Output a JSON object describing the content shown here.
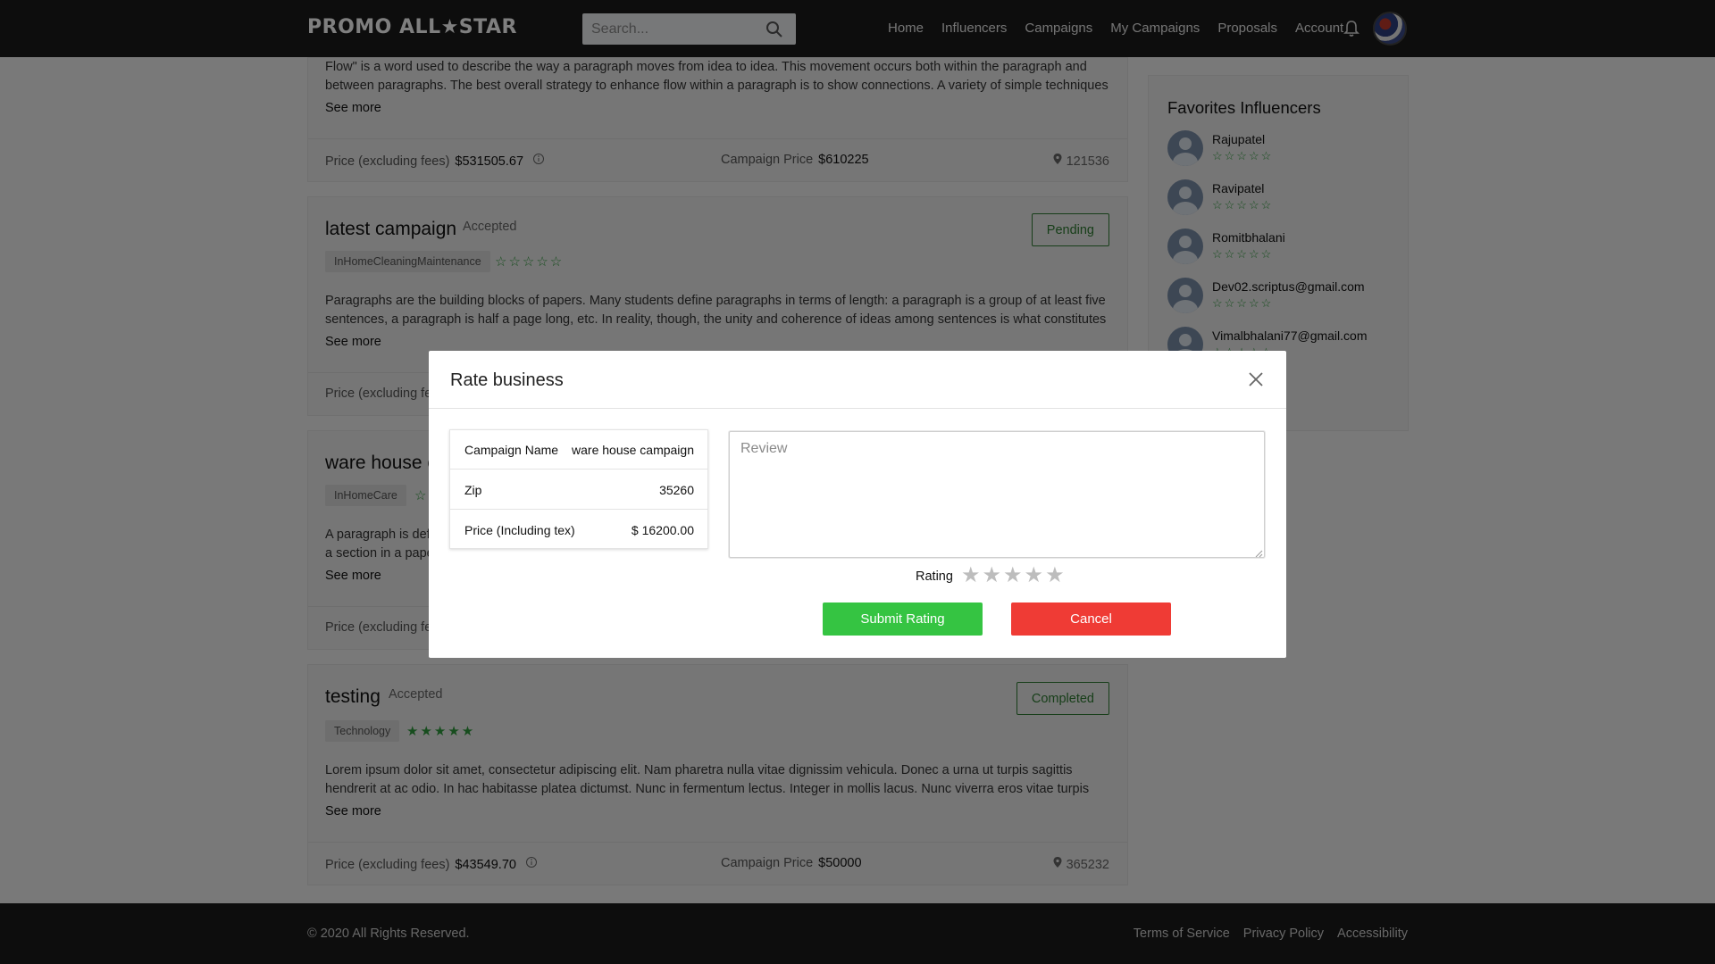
{
  "header": {
    "logo": "PROMO ALL★STAR",
    "search_placeholder": "Search...",
    "nav": [
      "Home",
      "Influencers",
      "Campaigns",
      "My Campaigns",
      "Proposals",
      "Account"
    ]
  },
  "campaigns": [
    {
      "description": "Flow\" is a word used to describe the way a paragraph moves from idea to idea. This movement occurs both within the paragraph and between paragraphs. The best overall strategy to enhance flow within a paragraph is to show connections. A variety of simple techniques",
      "see_more": "See more",
      "price_label": "Price (excluding fees)",
      "price_value": "$531505.67",
      "campaign_price_label": "Campaign Price",
      "campaign_price_value": "$610225",
      "zip": "121536"
    },
    {
      "title": "latest campaign",
      "status_text": "Accepted",
      "status_button": "Pending",
      "tag": "InHomeCleaningMaintenance",
      "stars": "☆☆☆☆☆",
      "description": "Paragraphs are the building blocks of papers. Many students define paragraphs in terms of length: a paragraph is a group of at least five sentences, a paragraph is half a page long, etc. In reality, though, the unity and coherence of ideas among sentences is what constitutes a",
      "see_more": "See more",
      "price_label": "Price (excluding fees)"
    },
    {
      "title": "ware house campaign",
      "tag": "InHomeCare",
      "stars": "☆",
      "description": "A paragraph is defined as a group of sentences or a single sentence that forms a unit. Length and appearance do not determine whether a section in a paper is a paragraph.",
      "see_more": "See more",
      "price_label": "Price (excluding fees)"
    },
    {
      "title": "testing",
      "status_text": "Accepted",
      "status_button": "Completed",
      "tag": "Technology",
      "stars": "★★★★★",
      "description": "Lorem ipsum dolor sit amet, consectetur adipiscing elit. Nam pharetra nulla vitae dignissim vehicula. Donec a urna ut turpis sagittis hendrerit at ac odio. In hac habitasse platea dictumst. Nunc in fermentum lectus. Integer in mollis lacus. Nunc viverra eros vitae turpis",
      "see_more": "See more",
      "price_label": "Price (excluding fees)",
      "price_value": "$43549.70",
      "campaign_price_label": "Campaign Price",
      "campaign_price_value": "$50000",
      "zip": "365232"
    }
  ],
  "favorites": {
    "title": "Favorites Influencers",
    "items": [
      {
        "name": "Rajupatel",
        "stars": "☆☆☆☆☆"
      },
      {
        "name": "Ravipatel",
        "stars": "☆☆☆☆☆"
      },
      {
        "name": "Romitbhalani",
        "stars": "☆☆☆☆☆"
      },
      {
        "name": "Dev02.scriptus@gmail.com",
        "stars": "☆☆☆☆☆"
      },
      {
        "name": "Vimalbhalani77@gmail.com",
        "stars": "☆☆☆☆☆"
      }
    ]
  },
  "footer": {
    "copyright": "© 2020 All Rights Reserved.",
    "links": [
      "Terms of Service",
      "Privacy Policy",
      "Accessibility"
    ]
  },
  "modal": {
    "title": "Rate business",
    "info": [
      {
        "label": "Campaign Name",
        "value": "ware house campaign"
      },
      {
        "label": "Zip",
        "value": "35260"
      },
      {
        "label": "Price (Including tex)",
        "value": "$ 16200.00"
      }
    ],
    "review_placeholder": "Review",
    "rating_label": "Rating",
    "rating_value": 0,
    "rating_max": 5,
    "submit_label": "Submit Rating",
    "cancel_label": "Cancel"
  },
  "colors": {
    "header_bg": "#1b1b1b",
    "accent_green": "#2e9b3c",
    "submit_green": "#35c442",
    "cancel_red": "#ef3b35"
  }
}
